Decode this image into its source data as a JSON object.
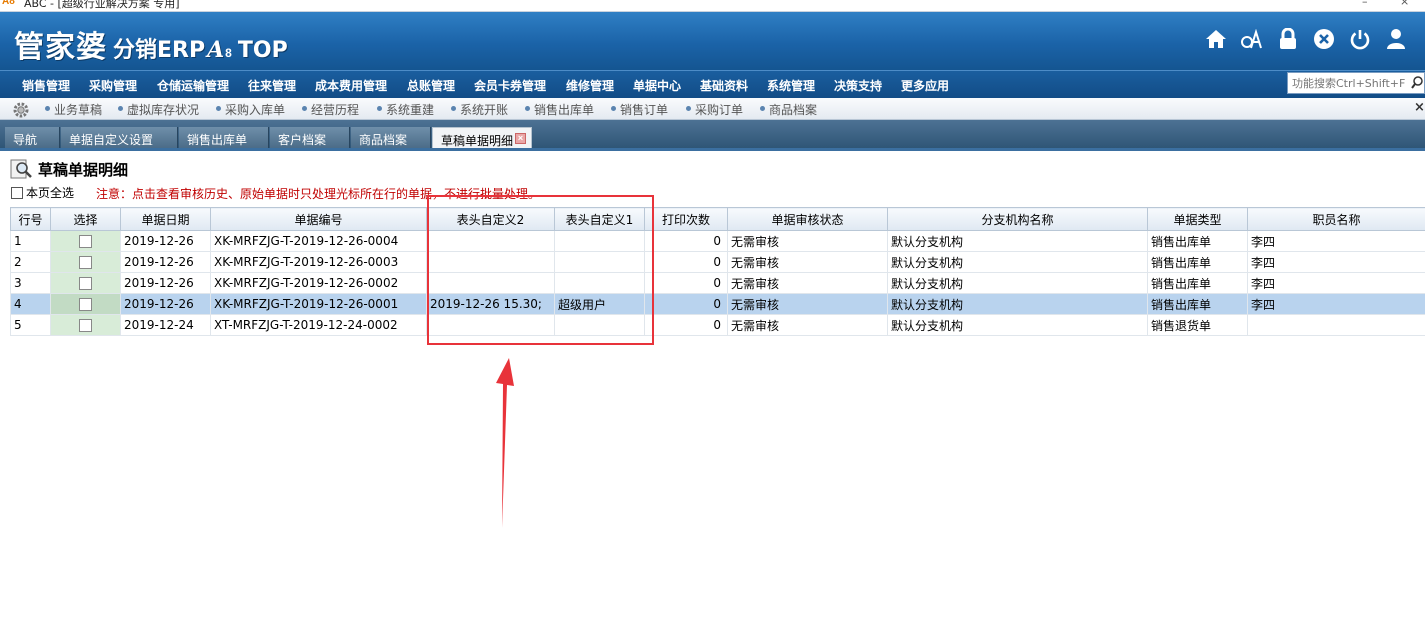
{
  "window": {
    "title": "ABC - [超级行业解决方案 专用]"
  },
  "brand": {
    "part1": "管家婆",
    "part2": "分销ERP",
    "part3": "A",
    "part4": "8",
    "part5": "TOP"
  },
  "header_icons": [
    "home-icon",
    "switch-user-icon",
    "lock-icon",
    "close-circle-icon",
    "power-icon",
    "user-icon"
  ],
  "menu": [
    "销售管理",
    "采购管理",
    "仓储运输管理",
    "往来管理",
    "成本费用管理",
    "总账管理",
    "会员卡券管理",
    "维修管理",
    "单据中心",
    "基础资料",
    "系统管理",
    "决策支持",
    "更多应用"
  ],
  "search": {
    "placeholder": "功能搜索Ctrl+Shift+F"
  },
  "quickbar": [
    "业务草稿",
    "虚拟库存状况",
    "采购入库单",
    "经营历程",
    "系统重建",
    "系统开账",
    "销售出库单",
    "销售订单",
    "采购订单",
    "商品档案"
  ],
  "tabs": [
    "导航",
    "单据自定义设置",
    "销售出库单",
    "客户档案",
    "商品档案",
    "草稿单据明细"
  ],
  "page": {
    "title": "草稿单据明细",
    "select_all": "本页全选",
    "notice": "注意：点击查看审核历史、原始单据时只处理光标所在行的单据，不进行批量处理。"
  },
  "grid": {
    "columns": [
      "行号",
      "选择",
      "单据日期",
      "单据编号",
      "表头自定义2",
      "表头自定义1",
      "打印次数",
      "单据审核状态",
      "分支机构名称",
      "单据类型",
      "职员名称"
    ],
    "rows": [
      [
        "1",
        "",
        "2019-12-26",
        "XK-MRFZJG-T-2019-12-26-0004",
        "",
        "",
        "0",
        "无需审核",
        "默认分支机构",
        "销售出库单",
        "李四"
      ],
      [
        "2",
        "",
        "2019-12-26",
        "XK-MRFZJG-T-2019-12-26-0003",
        "",
        "",
        "0",
        "无需审核",
        "默认分支机构",
        "销售出库单",
        "李四"
      ],
      [
        "3",
        "",
        "2019-12-26",
        "XK-MRFZJG-T-2019-12-26-0002",
        "",
        "",
        "0",
        "无需审核",
        "默认分支机构",
        "销售出库单",
        "李四"
      ],
      [
        "4",
        "",
        "2019-12-26",
        "XK-MRFZJG-T-2019-12-26-0001",
        "2019-12-26 15.30;",
        "超级用户",
        "0",
        "无需审核",
        "默认分支机构",
        "销售出库单",
        "李四"
      ],
      [
        "5",
        "",
        "2019-12-24",
        "XT-MRFZJG-T-2019-12-24-0002",
        "",
        "",
        "0",
        "无需审核",
        "默认分支机构",
        "销售退货单",
        ""
      ]
    ],
    "highlighted_row": 3
  },
  "colors": {
    "banner": "#1b63a8",
    "menu": "#124c86",
    "highlight_row": "#b9d3ee",
    "annotation": "#e8333a",
    "notice": "#c00000"
  }
}
